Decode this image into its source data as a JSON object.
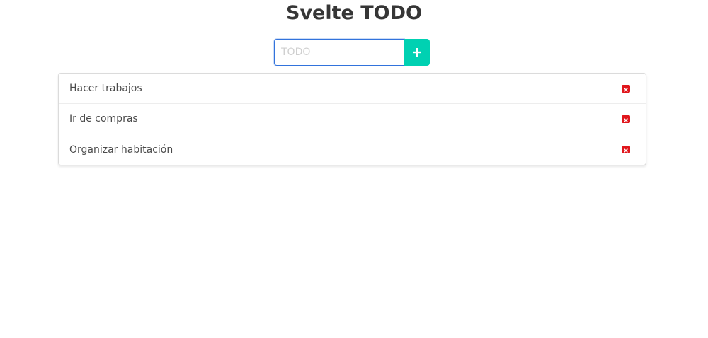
{
  "header": {
    "title": "Svelte TODO"
  },
  "form": {
    "placeholder": "TODO",
    "value": "",
    "add_icon": "plus-icon"
  },
  "todos": [
    {
      "label": "Hacer trabajos",
      "delete_icon": "close-icon"
    },
    {
      "label": "Ir de compras",
      "delete_icon": "close-icon"
    },
    {
      "label": "Organizar habitación",
      "delete_icon": "close-icon"
    }
  ],
  "colors": {
    "accent": "#00d1b2",
    "delete": "#e0161c",
    "focus_border": "#3273dc"
  }
}
